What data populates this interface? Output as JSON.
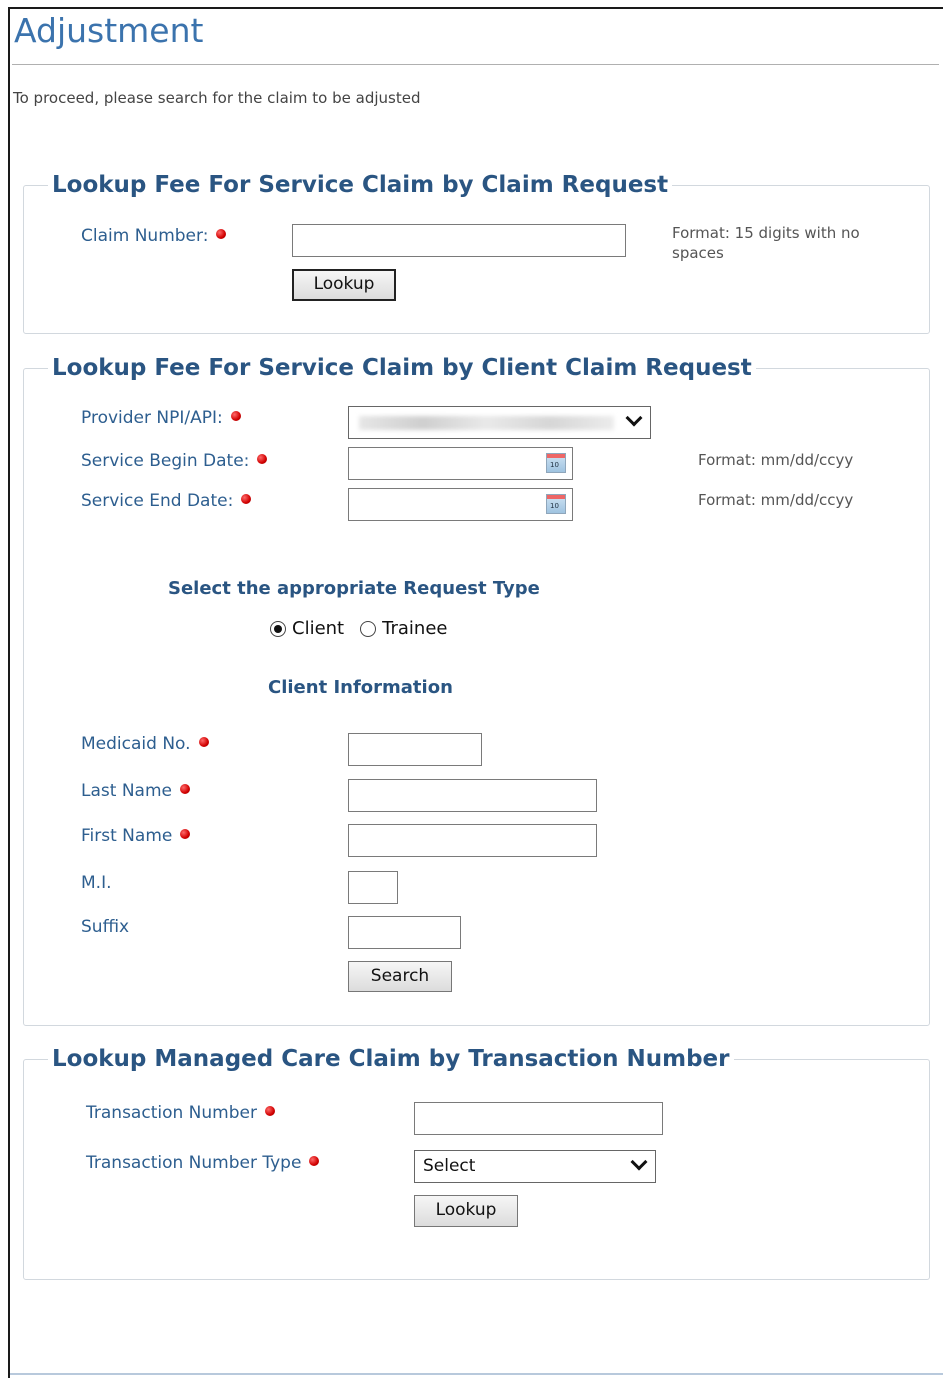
{
  "page": {
    "title": "Adjustment",
    "intro": "To proceed, please search for the claim to be adjusted"
  },
  "claim_request": {
    "legend": "Lookup Fee For Service Claim by Claim Request",
    "claim_number_label": "Claim Number:",
    "claim_number_value": "",
    "format_hint": "Format: 15 digits with no spaces",
    "lookup_label": "Lookup"
  },
  "client_claim": {
    "legend": "Lookup Fee For Service Claim by Client Claim Request",
    "provider_label": "Provider NPI/API:",
    "begin_date_label": "Service Begin Date:",
    "begin_date_hint": "Format: mm/dd/ccyy",
    "end_date_label": "Service End Date:",
    "end_date_hint": "Format: mm/dd/ccyy",
    "request_type_heading": "Select the appropriate Request Type",
    "request_types": [
      "Client",
      "Trainee"
    ],
    "selected_request_type": "Client",
    "client_info_heading": "Client Information",
    "medicaid_label": "Medicaid No.",
    "last_name_label": "Last Name",
    "first_name_label": "First Name",
    "mi_label": "M.I.",
    "suffix_label": "Suffix",
    "search_label": "Search"
  },
  "managed_care": {
    "legend": "Lookup Managed Care Claim by Transaction Number",
    "transaction_number_label": "Transaction Number",
    "transaction_type_label": "Transaction Number Type",
    "transaction_type_selected": "Select",
    "lookup_label": "Lookup"
  },
  "colors": {
    "title": "#3b73ad",
    "legend": "#2a5582",
    "label": "#2d5e8f",
    "required_dot": "#d10000"
  },
  "icons": {
    "required": "required-dot-icon",
    "calendar": "calendar-icon",
    "dropdown": "chevron-down-icon"
  }
}
